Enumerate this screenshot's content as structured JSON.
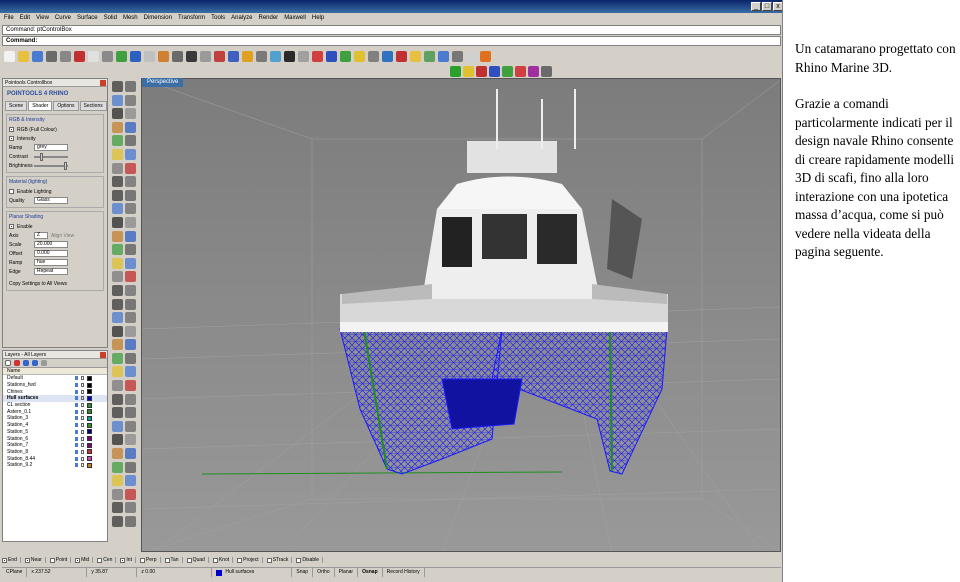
{
  "window": {
    "menu": [
      "File",
      "Edit",
      "View",
      "Curve",
      "Surface",
      "Solid",
      "Mesh",
      "Dimension",
      "Transform",
      "Tools",
      "Analyze",
      "Render",
      "Maxwell",
      "Help"
    ],
    "command_history": "Command: ptControlBox",
    "command_prompt": "Command:"
  },
  "pointools_panel": {
    "title": "Pointools Controllbox",
    "logo": "POINTOOLS 4 RHINO",
    "tabs": [
      "Scene",
      "Shader",
      "Options",
      "Sections"
    ],
    "active_tab": "Shader",
    "rgb_group": "RGB & Intensity",
    "rgb_check": "RGB (Full Colour)",
    "intensity_check": "Intensity",
    "ramp_label": "Ramp",
    "ramp_value": "grey",
    "contrast_label": "Contrast",
    "brightness_label": "Brightness",
    "material_group": "Material (lighting)",
    "enable_lighting": "Enable Lighting",
    "quality_label": "Quality",
    "quality_value": "Glass",
    "planar_group": "Planar Shading",
    "enable_check": "Enable",
    "axis_label": "Axis",
    "axis_value": "Z",
    "align_label": "Align View",
    "scale_label": "Scale",
    "scale_value": "20.000",
    "offset_label": "Offset",
    "offset_value": "0.000",
    "ramp2_label": "Ramp",
    "ramp2_value": "hue",
    "edge_label": "Edge",
    "edge_value": "Repeat",
    "copy_button": "Copy Settings to All Views"
  },
  "layers_panel": {
    "title": "Layers - All Layers",
    "column": "Name",
    "rows": [
      {
        "name": "Default",
        "color": "#000000"
      },
      {
        "name": "Stations_fwd",
        "color": "#000000"
      },
      {
        "name": "Chines",
        "color": "#000000"
      },
      {
        "name": "Hull surfaces",
        "color": "#0000cc",
        "current": true
      },
      {
        "name": "CL section",
        "color": "#2a8f2a"
      },
      {
        "name": "Astern_0.1",
        "color": "#2a8f2a"
      },
      {
        "name": "Station_3",
        "color": "#00a0a0"
      },
      {
        "name": "Station_4",
        "color": "#2a8f2a"
      },
      {
        "name": "Station_5",
        "color": "#000080"
      },
      {
        "name": "Station_6",
        "color": "#800080"
      },
      {
        "name": "Station_7",
        "color": "#800080"
      },
      {
        "name": "Station_8",
        "color": "#c03030"
      },
      {
        "name": "Station_8.44",
        "color": "#d040c0"
      },
      {
        "name": "Station_9.2",
        "color": "#c08020"
      }
    ]
  },
  "viewport": {
    "label": "Perspective"
  },
  "osnap": [
    {
      "label": "End",
      "on": true
    },
    {
      "label": "Near",
      "on": true
    },
    {
      "label": "Point",
      "on": false
    },
    {
      "label": "Mid",
      "on": true
    },
    {
      "label": "Cen",
      "on": false
    },
    {
      "label": "Int",
      "on": true
    },
    {
      "label": "Perp",
      "on": false
    },
    {
      "label": "Tan",
      "on": false
    },
    {
      "label": "Quad",
      "on": false
    },
    {
      "label": "Knot",
      "on": false
    },
    {
      "label": "Project",
      "on": false
    },
    {
      "label": "STrack",
      "on": false
    },
    {
      "label": "Disable",
      "on": false
    }
  ],
  "status": {
    "cplane": "CPlane",
    "x": "x 237.52",
    "y": "y 35.87",
    "z": "z 0.00",
    "layer": "Hull surfaces",
    "layer_color": "#0000cc",
    "snap": "Snap",
    "ortho": "Ortho",
    "planar": "Planar",
    "osnap": "Osnap",
    "record": "Record History"
  },
  "caption": {
    "p1": "Un catamarano progettato con Rhino Marine 3D.",
    "p2": "Grazie a comandi particolarmente indicati per il design navale Rhino consente di creare rapidamente modelli 3D di scafi, fino alla loro interazione con una ipotetica massa d’acqua, come si può vedere nella videata della pagina seguente."
  },
  "colors": {
    "hull_wire": "#1a1aff",
    "viewport_bg": "#8a8a8a",
    "title_bar": "#0a246a",
    "accent": "#3a6ea5"
  }
}
